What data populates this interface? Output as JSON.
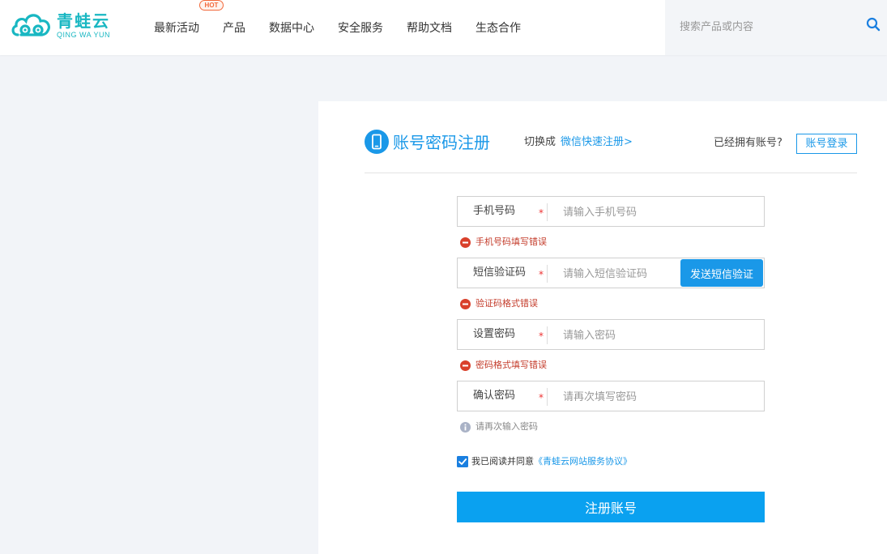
{
  "header": {
    "logo_cn": "青蛙云",
    "logo_en": "QING WA YUN",
    "nav": [
      {
        "label": "最新活动",
        "badge": "HOT"
      },
      {
        "label": "产品"
      },
      {
        "label": "数据中心"
      },
      {
        "label": "安全服务"
      },
      {
        "label": "帮助文档"
      },
      {
        "label": "生态合作"
      }
    ],
    "search_placeholder": "搜索产品或内容"
  },
  "register": {
    "title": "账号密码注册",
    "switch_label": "切换成",
    "switch_link": "微信快速注册>",
    "have_account": "已经拥有账号?",
    "login_button": "账号登录",
    "fields": [
      {
        "label": "手机号码",
        "required": "*",
        "placeholder": "请输入手机号码",
        "message": "手机号码填写错误",
        "message_type": "error"
      },
      {
        "label": "短信验证码",
        "required": "*",
        "placeholder": "请输入短信验证码",
        "message": "验证码格式错误",
        "message_type": "error",
        "action": "发送短信验证"
      },
      {
        "label": "设置密码",
        "required": "*",
        "placeholder": "请输入密码",
        "message": "密码格式填写错误",
        "message_type": "error"
      },
      {
        "label": "确认密码",
        "required": "*",
        "placeholder": "请再次填写密码",
        "message": "请再次输入密码",
        "message_type": "info"
      }
    ],
    "agree_checked": true,
    "agree_text": "我已阅读并同意",
    "agree_link": "《青蛙云网站服务协议》",
    "submit": "注册账号"
  },
  "colors": {
    "brand": "#19b7c2",
    "accent": "#1a98e8",
    "submit": "#0aa1f0",
    "error": "#c43c2b",
    "hot": "#f2693b"
  }
}
